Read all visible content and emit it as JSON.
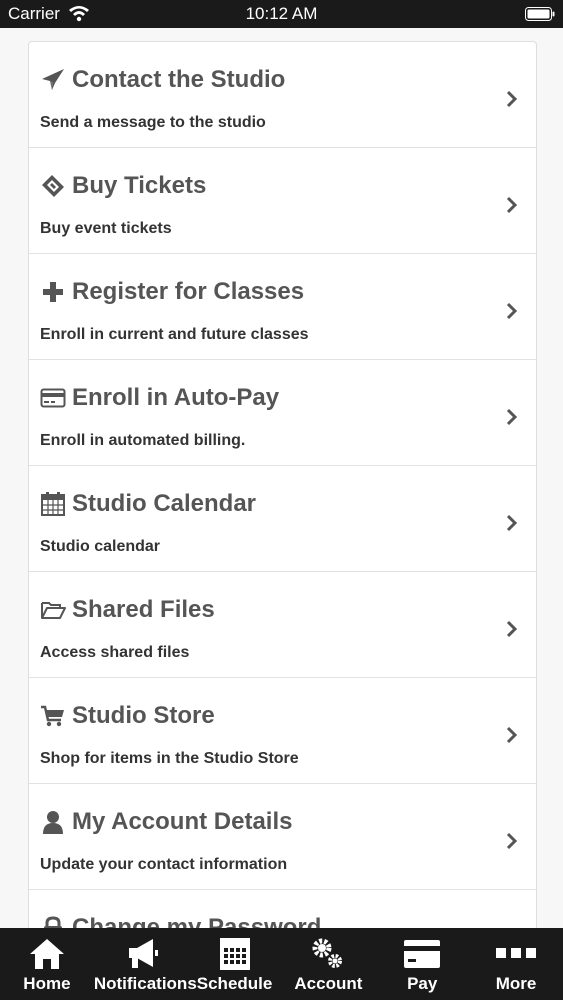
{
  "status": {
    "carrier": "Carrier",
    "time": "10:12 AM"
  },
  "menu": [
    {
      "title": "Contact the Studio",
      "subtitle": "Send a message to the studio",
      "icon": "paper-plane-icon"
    },
    {
      "title": "Buy Tickets",
      "subtitle": "Buy event tickets",
      "icon": "ticket-icon"
    },
    {
      "title": "Register for Classes",
      "subtitle": "Enroll in current and future classes",
      "icon": "plus-icon"
    },
    {
      "title": "Enroll in Auto-Pay",
      "subtitle": "Enroll in automated billing.",
      "icon": "credit-card-icon"
    },
    {
      "title": "Studio Calendar",
      "subtitle": "Studio calendar",
      "icon": "calendar-icon"
    },
    {
      "title": "Shared Files",
      "subtitle": "Access shared files",
      "icon": "folder-open-icon"
    },
    {
      "title": "Studio Store",
      "subtitle": "Shop for items in the Studio Store",
      "icon": "shopping-cart-icon"
    },
    {
      "title": "My Account Details",
      "subtitle": "Update your contact information",
      "icon": "user-icon"
    },
    {
      "title": "Change my Password",
      "subtitle": "",
      "icon": "lock-icon"
    }
  ],
  "tabs": [
    {
      "label": "Home",
      "icon": "home-icon"
    },
    {
      "label": "Notifications",
      "icon": "megaphone-icon"
    },
    {
      "label": "Schedule",
      "icon": "calendar-grid-icon"
    },
    {
      "label": "Account",
      "icon": "gears-icon"
    },
    {
      "label": "Pay",
      "icon": "card-icon"
    },
    {
      "label": "More",
      "icon": "more-icon"
    }
  ],
  "colors": {
    "title_text": "#555555",
    "subtitle_text": "#333333",
    "bar_background": "#1a1a1a"
  }
}
